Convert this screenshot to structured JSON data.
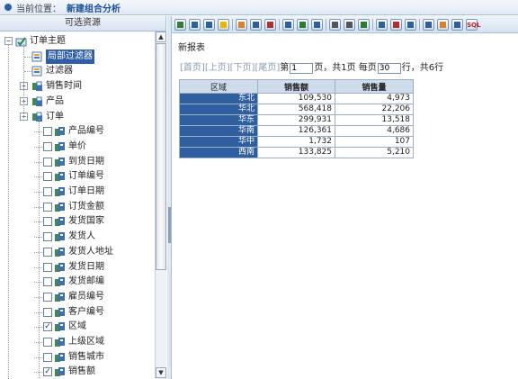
{
  "breadcrumb": {
    "label": "当前位置：",
    "value": "新建组合分析"
  },
  "left_panel": {
    "title": "可选资源",
    "tree": [
      {
        "label": "订单主题",
        "level": 0,
        "expander": "−",
        "checkbox": false,
        "checked": false,
        "selected": false,
        "icon": "check-folder-icon"
      },
      {
        "label": "局部过滤器",
        "level": 1,
        "expander": "",
        "checkbox": false,
        "checked": false,
        "selected": true,
        "icon": "filter-icon"
      },
      {
        "label": "过滤器",
        "level": 1,
        "expander": "",
        "checkbox": false,
        "checked": false,
        "selected": false,
        "icon": "filter-icon"
      },
      {
        "label": "销售时间",
        "level": 1,
        "expander": "+",
        "checkbox": false,
        "checked": false,
        "selected": false,
        "icon": "dimension-icon"
      },
      {
        "label": "产品",
        "level": 1,
        "expander": "+",
        "checkbox": false,
        "checked": false,
        "selected": false,
        "icon": "dimension-icon"
      },
      {
        "label": "订单",
        "level": 1,
        "expander": "−",
        "checkbox": false,
        "checked": false,
        "selected": false,
        "icon": "dimension-icon"
      },
      {
        "label": "产品编号",
        "level": 2,
        "expander": "",
        "checkbox": true,
        "checked": false,
        "selected": false,
        "icon": "field-icon"
      },
      {
        "label": "单价",
        "level": 2,
        "expander": "",
        "checkbox": true,
        "checked": false,
        "selected": false,
        "icon": "field-icon"
      },
      {
        "label": "到货日期",
        "level": 2,
        "expander": "",
        "checkbox": true,
        "checked": false,
        "selected": false,
        "icon": "field-icon"
      },
      {
        "label": "订单编号",
        "level": 2,
        "expander": "",
        "checkbox": true,
        "checked": false,
        "selected": false,
        "icon": "field-icon"
      },
      {
        "label": "订单日期",
        "level": 2,
        "expander": "",
        "checkbox": true,
        "checked": false,
        "selected": false,
        "icon": "field-icon"
      },
      {
        "label": "订货金额",
        "level": 2,
        "expander": "",
        "checkbox": true,
        "checked": false,
        "selected": false,
        "icon": "field-icon"
      },
      {
        "label": "发货国家",
        "level": 2,
        "expander": "",
        "checkbox": true,
        "checked": false,
        "selected": false,
        "icon": "field-icon"
      },
      {
        "label": "发货人",
        "level": 2,
        "expander": "",
        "checkbox": true,
        "checked": false,
        "selected": false,
        "icon": "field-icon"
      },
      {
        "label": "发货人地址",
        "level": 2,
        "expander": "",
        "checkbox": true,
        "checked": false,
        "selected": false,
        "icon": "field-icon"
      },
      {
        "label": "发货日期",
        "level": 2,
        "expander": "",
        "checkbox": true,
        "checked": false,
        "selected": false,
        "icon": "field-icon"
      },
      {
        "label": "发货邮编",
        "level": 2,
        "expander": "",
        "checkbox": true,
        "checked": false,
        "selected": false,
        "icon": "field-icon"
      },
      {
        "label": "雇员编号",
        "level": 2,
        "expander": "",
        "checkbox": true,
        "checked": false,
        "selected": false,
        "icon": "field-icon"
      },
      {
        "label": "客户编号",
        "level": 2,
        "expander": "",
        "checkbox": true,
        "checked": false,
        "selected": false,
        "icon": "field-icon"
      },
      {
        "label": "区域",
        "level": 2,
        "expander": "",
        "checkbox": true,
        "checked": true,
        "selected": false,
        "icon": "field-icon"
      },
      {
        "label": "上级区域",
        "level": 2,
        "expander": "",
        "checkbox": true,
        "checked": false,
        "selected": false,
        "icon": "field-icon"
      },
      {
        "label": "销售城市",
        "level": 2,
        "expander": "",
        "checkbox": true,
        "checked": false,
        "selected": false,
        "icon": "field-icon"
      },
      {
        "label": "销售额",
        "level": 2,
        "expander": "",
        "checkbox": true,
        "checked": true,
        "selected": false,
        "icon": "field-icon"
      }
    ]
  },
  "toolbar": {
    "buttons": [
      {
        "icon": "refresh-icon",
        "color": "#3a7a3a"
      },
      {
        "icon": "save-icon",
        "color": "#2f5f9e"
      },
      {
        "icon": "save-as-icon",
        "color": "#2f5f9e"
      },
      {
        "icon": "favorite-star-icon",
        "color": "#e6b800"
      },
      {
        "sep": true
      },
      {
        "icon": "chart-icon",
        "color": "#d9822b"
      },
      {
        "icon": "table-icon",
        "color": "#2f5f9e"
      },
      {
        "icon": "sort-icon",
        "color": "#b03030"
      },
      {
        "sep": true
      },
      {
        "icon": "drill-icon",
        "color": "#2f5f9e"
      },
      {
        "icon": "export-excel-icon",
        "color": "#2f7a2f"
      },
      {
        "icon": "export-pdf-icon",
        "color": "#2f5f9e"
      },
      {
        "sep": true
      },
      {
        "icon": "print-icon",
        "color": "#555555"
      },
      {
        "icon": "print-setup-icon",
        "color": "#555555"
      },
      {
        "icon": "swap-axis-icon",
        "color": "#2f7a2f"
      },
      {
        "sep": true
      },
      {
        "icon": "filter-icon",
        "color": "#2f5f9e"
      },
      {
        "icon": "format-icon",
        "color": "#b03030"
      },
      {
        "icon": "param-icon",
        "color": "#2f5f9e"
      },
      {
        "sep": true
      },
      {
        "icon": "layout-icon",
        "color": "#2f5f9e"
      },
      {
        "icon": "info-icon",
        "color": "#d9822b"
      },
      {
        "icon": "query-icon",
        "color": "#2f5f9e"
      },
      {
        "icon": "sql-icon",
        "label": "SQL",
        "color": "#c02020"
      }
    ]
  },
  "report": {
    "title": "新报表",
    "pager": {
      "first": "[首页]",
      "prev": "[上页]",
      "next": "[下页]",
      "last": "[尾页]",
      "page_prefix": "第",
      "page_value": "1",
      "page_suffix": "页，共1页 每页",
      "per_page_value": "30",
      "rows_suffix": "行，共6行"
    },
    "columns": [
      "区域",
      "销售额",
      "销售量"
    ],
    "rows": [
      [
        "东北",
        "109,530",
        "4,973"
      ],
      [
        "华北",
        "568,418",
        "22,206"
      ],
      [
        "华东",
        "299,931",
        "13,518"
      ],
      [
        "华南",
        "126,361",
        "4,686"
      ],
      [
        "华中",
        "1,732",
        "107"
      ],
      [
        "西南",
        "133,825",
        "5,210"
      ]
    ]
  }
}
